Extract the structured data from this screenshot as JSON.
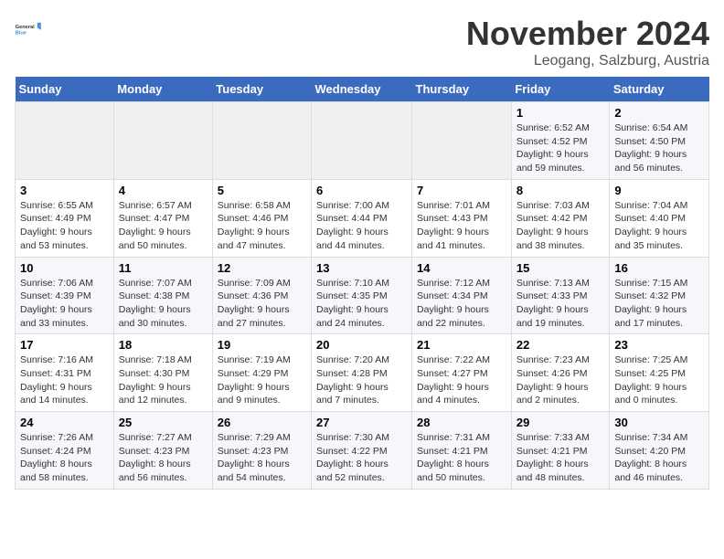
{
  "logo": {
    "line1": "General",
    "line2": "Blue"
  },
  "title": "November 2024",
  "subtitle": "Leogang, Salzburg, Austria",
  "days_of_week": [
    "Sunday",
    "Monday",
    "Tuesday",
    "Wednesday",
    "Thursday",
    "Friday",
    "Saturday"
  ],
  "weeks": [
    [
      {
        "day": "",
        "info": ""
      },
      {
        "day": "",
        "info": ""
      },
      {
        "day": "",
        "info": ""
      },
      {
        "day": "",
        "info": ""
      },
      {
        "day": "",
        "info": ""
      },
      {
        "day": "1",
        "info": "Sunrise: 6:52 AM\nSunset: 4:52 PM\nDaylight: 9 hours and 59 minutes."
      },
      {
        "day": "2",
        "info": "Sunrise: 6:54 AM\nSunset: 4:50 PM\nDaylight: 9 hours and 56 minutes."
      }
    ],
    [
      {
        "day": "3",
        "info": "Sunrise: 6:55 AM\nSunset: 4:49 PM\nDaylight: 9 hours and 53 minutes."
      },
      {
        "day": "4",
        "info": "Sunrise: 6:57 AM\nSunset: 4:47 PM\nDaylight: 9 hours and 50 minutes."
      },
      {
        "day": "5",
        "info": "Sunrise: 6:58 AM\nSunset: 4:46 PM\nDaylight: 9 hours and 47 minutes."
      },
      {
        "day": "6",
        "info": "Sunrise: 7:00 AM\nSunset: 4:44 PM\nDaylight: 9 hours and 44 minutes."
      },
      {
        "day": "7",
        "info": "Sunrise: 7:01 AM\nSunset: 4:43 PM\nDaylight: 9 hours and 41 minutes."
      },
      {
        "day": "8",
        "info": "Sunrise: 7:03 AM\nSunset: 4:42 PM\nDaylight: 9 hours and 38 minutes."
      },
      {
        "day": "9",
        "info": "Sunrise: 7:04 AM\nSunset: 4:40 PM\nDaylight: 9 hours and 35 minutes."
      }
    ],
    [
      {
        "day": "10",
        "info": "Sunrise: 7:06 AM\nSunset: 4:39 PM\nDaylight: 9 hours and 33 minutes."
      },
      {
        "day": "11",
        "info": "Sunrise: 7:07 AM\nSunset: 4:38 PM\nDaylight: 9 hours and 30 minutes."
      },
      {
        "day": "12",
        "info": "Sunrise: 7:09 AM\nSunset: 4:36 PM\nDaylight: 9 hours and 27 minutes."
      },
      {
        "day": "13",
        "info": "Sunrise: 7:10 AM\nSunset: 4:35 PM\nDaylight: 9 hours and 24 minutes."
      },
      {
        "day": "14",
        "info": "Sunrise: 7:12 AM\nSunset: 4:34 PM\nDaylight: 9 hours and 22 minutes."
      },
      {
        "day": "15",
        "info": "Sunrise: 7:13 AM\nSunset: 4:33 PM\nDaylight: 9 hours and 19 minutes."
      },
      {
        "day": "16",
        "info": "Sunrise: 7:15 AM\nSunset: 4:32 PM\nDaylight: 9 hours and 17 minutes."
      }
    ],
    [
      {
        "day": "17",
        "info": "Sunrise: 7:16 AM\nSunset: 4:31 PM\nDaylight: 9 hours and 14 minutes."
      },
      {
        "day": "18",
        "info": "Sunrise: 7:18 AM\nSunset: 4:30 PM\nDaylight: 9 hours and 12 minutes."
      },
      {
        "day": "19",
        "info": "Sunrise: 7:19 AM\nSunset: 4:29 PM\nDaylight: 9 hours and 9 minutes."
      },
      {
        "day": "20",
        "info": "Sunrise: 7:20 AM\nSunset: 4:28 PM\nDaylight: 9 hours and 7 minutes."
      },
      {
        "day": "21",
        "info": "Sunrise: 7:22 AM\nSunset: 4:27 PM\nDaylight: 9 hours and 4 minutes."
      },
      {
        "day": "22",
        "info": "Sunrise: 7:23 AM\nSunset: 4:26 PM\nDaylight: 9 hours and 2 minutes."
      },
      {
        "day": "23",
        "info": "Sunrise: 7:25 AM\nSunset: 4:25 PM\nDaylight: 9 hours and 0 minutes."
      }
    ],
    [
      {
        "day": "24",
        "info": "Sunrise: 7:26 AM\nSunset: 4:24 PM\nDaylight: 8 hours and 58 minutes."
      },
      {
        "day": "25",
        "info": "Sunrise: 7:27 AM\nSunset: 4:23 PM\nDaylight: 8 hours and 56 minutes."
      },
      {
        "day": "26",
        "info": "Sunrise: 7:29 AM\nSunset: 4:23 PM\nDaylight: 8 hours and 54 minutes."
      },
      {
        "day": "27",
        "info": "Sunrise: 7:30 AM\nSunset: 4:22 PM\nDaylight: 8 hours and 52 minutes."
      },
      {
        "day": "28",
        "info": "Sunrise: 7:31 AM\nSunset: 4:21 PM\nDaylight: 8 hours and 50 minutes."
      },
      {
        "day": "29",
        "info": "Sunrise: 7:33 AM\nSunset: 4:21 PM\nDaylight: 8 hours and 48 minutes."
      },
      {
        "day": "30",
        "info": "Sunrise: 7:34 AM\nSunset: 4:20 PM\nDaylight: 8 hours and 46 minutes."
      }
    ]
  ]
}
